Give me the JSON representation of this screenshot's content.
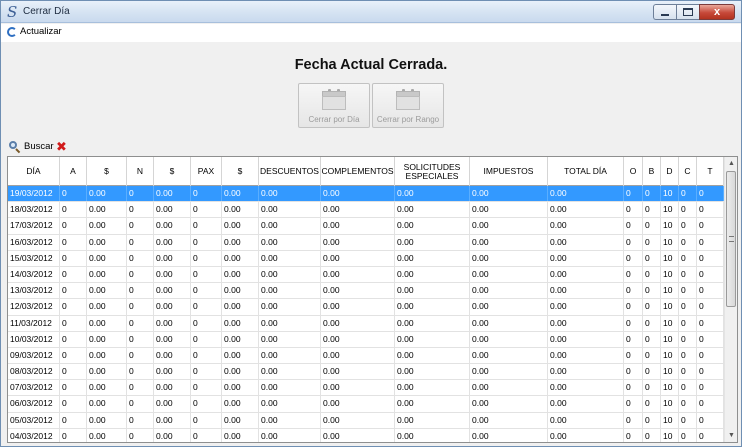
{
  "window": {
    "title": "Cerrar Día",
    "app_icon": "S",
    "close_glyph": "x"
  },
  "menu": {
    "refresh_label": "Actualizar"
  },
  "panel": {
    "status": "Fecha Actual Cerrada.",
    "btn_day": "Cerrar por Día",
    "btn_range": "Cerrar por Rango"
  },
  "search": {
    "label": "Buscar",
    "clear_glyph": "✖"
  },
  "table": {
    "headers": [
      "DÍA",
      "A",
      "$",
      "N",
      "$",
      "PAX",
      "$",
      "DESCUENTOS",
      "COMPLEMENTOS",
      "SOLICITUDES ESPECIALES",
      "IMPUESTOS",
      "TOTAL DÍA",
      "O",
      "B",
      "D",
      "C",
      "T"
    ],
    "rows": [
      [
        "19/03/2012",
        "0",
        "0.00",
        "0",
        "0.00",
        "0",
        "0.00",
        "0.00",
        "0.00",
        "0.00",
        "0.00",
        "0.00",
        "0",
        "0",
        "10",
        "0",
        "0"
      ],
      [
        "18/03/2012",
        "0",
        "0.00",
        "0",
        "0.00",
        "0",
        "0.00",
        "0.00",
        "0.00",
        "0.00",
        "0.00",
        "0.00",
        "0",
        "0",
        "10",
        "0",
        "0"
      ],
      [
        "17/03/2012",
        "0",
        "0.00",
        "0",
        "0.00",
        "0",
        "0.00",
        "0.00",
        "0.00",
        "0.00",
        "0.00",
        "0.00",
        "0",
        "0",
        "10",
        "0",
        "0"
      ],
      [
        "16/03/2012",
        "0",
        "0.00",
        "0",
        "0.00",
        "0",
        "0.00",
        "0.00",
        "0.00",
        "0.00",
        "0.00",
        "0.00",
        "0",
        "0",
        "10",
        "0",
        "0"
      ],
      [
        "15/03/2012",
        "0",
        "0.00",
        "0",
        "0.00",
        "0",
        "0.00",
        "0.00",
        "0.00",
        "0.00",
        "0.00",
        "0.00",
        "0",
        "0",
        "10",
        "0",
        "0"
      ],
      [
        "14/03/2012",
        "0",
        "0.00",
        "0",
        "0.00",
        "0",
        "0.00",
        "0.00",
        "0.00",
        "0.00",
        "0.00",
        "0.00",
        "0",
        "0",
        "10",
        "0",
        "0"
      ],
      [
        "13/03/2012",
        "0",
        "0.00",
        "0",
        "0.00",
        "0",
        "0.00",
        "0.00",
        "0.00",
        "0.00",
        "0.00",
        "0.00",
        "0",
        "0",
        "10",
        "0",
        "0"
      ],
      [
        "12/03/2012",
        "0",
        "0.00",
        "0",
        "0.00",
        "0",
        "0.00",
        "0.00",
        "0.00",
        "0.00",
        "0.00",
        "0.00",
        "0",
        "0",
        "10",
        "0",
        "0"
      ],
      [
        "11/03/2012",
        "0",
        "0.00",
        "0",
        "0.00",
        "0",
        "0.00",
        "0.00",
        "0.00",
        "0.00",
        "0.00",
        "0.00",
        "0",
        "0",
        "10",
        "0",
        "0"
      ],
      [
        "10/03/2012",
        "0",
        "0.00",
        "0",
        "0.00",
        "0",
        "0.00",
        "0.00",
        "0.00",
        "0.00",
        "0.00",
        "0.00",
        "0",
        "0",
        "10",
        "0",
        "0"
      ],
      [
        "09/03/2012",
        "0",
        "0.00",
        "0",
        "0.00",
        "0",
        "0.00",
        "0.00",
        "0.00",
        "0.00",
        "0.00",
        "0.00",
        "0",
        "0",
        "10",
        "0",
        "0"
      ],
      [
        "08/03/2012",
        "0",
        "0.00",
        "0",
        "0.00",
        "0",
        "0.00",
        "0.00",
        "0.00",
        "0.00",
        "0.00",
        "0.00",
        "0",
        "0",
        "10",
        "0",
        "0"
      ],
      [
        "07/03/2012",
        "0",
        "0.00",
        "0",
        "0.00",
        "0",
        "0.00",
        "0.00",
        "0.00",
        "0.00",
        "0.00",
        "0.00",
        "0",
        "0",
        "10",
        "0",
        "0"
      ],
      [
        "06/03/2012",
        "0",
        "0.00",
        "0",
        "0.00",
        "0",
        "0.00",
        "0.00",
        "0.00",
        "0.00",
        "0.00",
        "0.00",
        "0",
        "0",
        "10",
        "0",
        "0"
      ],
      [
        "05/03/2012",
        "0",
        "0.00",
        "0",
        "0.00",
        "0",
        "0.00",
        "0.00",
        "0.00",
        "0.00",
        "0.00",
        "0.00",
        "0",
        "0",
        "10",
        "0",
        "0"
      ],
      [
        "04/03/2012",
        "0",
        "0.00",
        "0",
        "0.00",
        "0",
        "0.00",
        "0.00",
        "0.00",
        "0.00",
        "0.00",
        "0.00",
        "0",
        "0",
        "10",
        "0",
        "0"
      ]
    ],
    "selected_row": 0
  },
  "colors": {
    "selection": "#3399ff",
    "clear_red": "#d11b1b"
  },
  "icons": [
    "app-icon",
    "refresh-icon",
    "calendar-icon",
    "search-icon",
    "clear-icon",
    "minimize-icon",
    "maximize-icon",
    "close-icon"
  ]
}
